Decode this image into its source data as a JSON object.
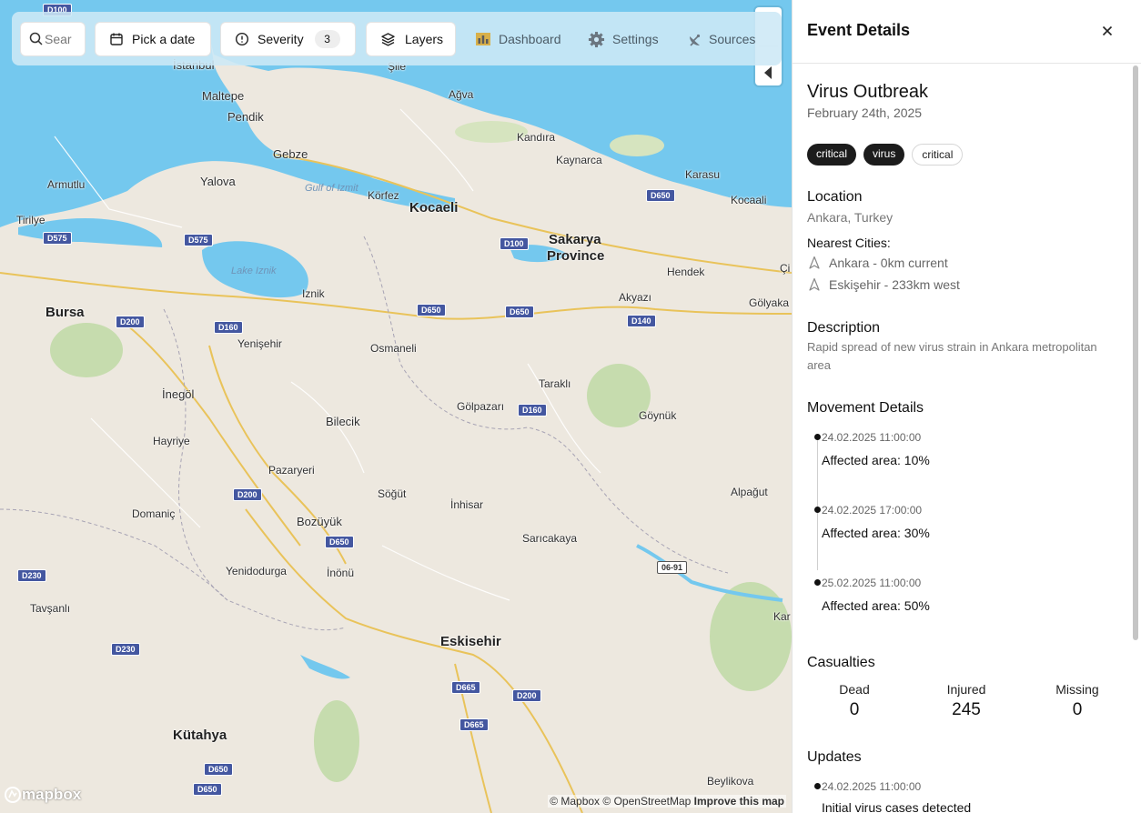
{
  "topbar": {
    "search_placeholder": "Sear",
    "date_label": "Pick a date",
    "severity_label": "Severity",
    "severity_count": "3",
    "layers_label": "Layers",
    "dashboard_label": "Dashboard",
    "settings_label": "Settings",
    "sources_label": "Sources"
  },
  "map": {
    "places": [
      {
        "name": "Maltepe",
        "size": "mid"
      },
      {
        "name": "Pendik",
        "size": "mid"
      },
      {
        "name": "Gebze",
        "size": "mid"
      },
      {
        "name": "Yalova",
        "size": "mid"
      },
      {
        "name": "Armutlu",
        "size": "small"
      },
      {
        "name": "Tirilye",
        "size": "small"
      },
      {
        "name": "Körfez",
        "size": "small"
      },
      {
        "name": "Kocaeli",
        "size": "big"
      },
      {
        "name": "Kandıra",
        "size": "small"
      },
      {
        "name": "Kaynarca",
        "size": "small"
      },
      {
        "name": "Karasu",
        "size": "small"
      },
      {
        "name": "Kocaali",
        "size": "small"
      },
      {
        "name": "Şile",
        "size": "small"
      },
      {
        "name": "Ağva",
        "size": "small"
      },
      {
        "name": "Sakarya",
        "size": "big"
      },
      {
        "name": "Province",
        "size": "big"
      },
      {
        "name": "Hendek",
        "size": "small"
      },
      {
        "name": "Akyazı",
        "size": "small"
      },
      {
        "name": "Gölyaka",
        "size": "small"
      },
      {
        "name": "Çi",
        "size": "small"
      },
      {
        "name": "Lake Iznik",
        "size": "water"
      },
      {
        "name": "Gulf of Izmit",
        "size": "water"
      },
      {
        "name": "Iznik",
        "size": "small"
      },
      {
        "name": "Bursa",
        "size": "big"
      },
      {
        "name": "Yenişehir",
        "size": "small"
      },
      {
        "name": "Osmaneli",
        "size": "small"
      },
      {
        "name": "İnegöl",
        "size": "mid"
      },
      {
        "name": "Bilecik",
        "size": "mid"
      },
      {
        "name": "Taraklı",
        "size": "small"
      },
      {
        "name": "Gölpazarı",
        "size": "small"
      },
      {
        "name": "Göynük",
        "size": "small"
      },
      {
        "name": "Hayriye",
        "size": "small"
      },
      {
        "name": "Pazaryeri",
        "size": "small"
      },
      {
        "name": "Söğüt",
        "size": "small"
      },
      {
        "name": "İnhisar",
        "size": "small"
      },
      {
        "name": "Alpağut",
        "size": "small"
      },
      {
        "name": "Domaniç",
        "size": "small"
      },
      {
        "name": "Bozüyük",
        "size": "mid"
      },
      {
        "name": "Sarıcakaya",
        "size": "small"
      },
      {
        "name": "Yenidodurga",
        "size": "small"
      },
      {
        "name": "İnönü",
        "size": "small"
      },
      {
        "name": "Tavşanlı",
        "size": "small"
      },
      {
        "name": "Eskisehir",
        "size": "big"
      },
      {
        "name": "Kar",
        "size": "small"
      },
      {
        "name": "Kütahya",
        "size": "big"
      },
      {
        "name": "Beylikova",
        "size": "small"
      },
      {
        "name": "İstanbul",
        "size": "mid"
      }
    ],
    "shields": [
      "D100",
      "D650",
      "D575",
      "D575",
      "D100",
      "D650",
      "D650",
      "D200",
      "D160",
      "D140",
      "D160",
      "D200",
      "D650",
      "D230",
      "D230",
      "D665",
      "D200",
      "D665",
      "D650",
      "D650",
      "06-91"
    ],
    "attribution_mapbox": "© Mapbox",
    "attribution_osm": "© OpenStreetMap",
    "attribution_improve": "Improve this map",
    "logo_text": "mapbox"
  },
  "panel": {
    "title": "Event Details",
    "event": {
      "title": "Virus Outbreak",
      "date": "February 24th, 2025",
      "tags": [
        "critical",
        "virus",
        "critical"
      ]
    },
    "location": {
      "heading": "Location",
      "value": "Ankara, Turkey",
      "nearest_heading": "Nearest Cities:",
      "cities": [
        "Ankara - 0km current",
        "Eskişehir - 233km west"
      ]
    },
    "description": {
      "heading": "Description",
      "text": "Rapid spread of new virus strain in Ankara metropolitan area"
    },
    "movement": {
      "heading": "Movement Details",
      "items": [
        {
          "time": "24.02.2025 11:00:00",
          "text": "Affected area: 10%"
        },
        {
          "time": "24.02.2025 17:00:00",
          "text": "Affected area: 30%"
        },
        {
          "time": "25.02.2025 11:00:00",
          "text": "Affected area: 50%"
        }
      ]
    },
    "casualties": {
      "heading": "Casualties",
      "dead_label": "Dead",
      "dead": "0",
      "injured_label": "Injured",
      "injured": "245",
      "missing_label": "Missing",
      "missing": "0"
    },
    "updates": {
      "heading": "Updates",
      "items": [
        {
          "time": "24.02.2025 11:00:00",
          "text": "Initial virus cases detected"
        }
      ]
    }
  },
  "colors": {
    "water": "#74c8ee",
    "land": "#ede8df",
    "forest": "#c6dcae",
    "highway": "#e9c35a",
    "shield": "#4457a0",
    "topbar": "#cde8f6",
    "tag_dark": "#1c1c1c"
  }
}
